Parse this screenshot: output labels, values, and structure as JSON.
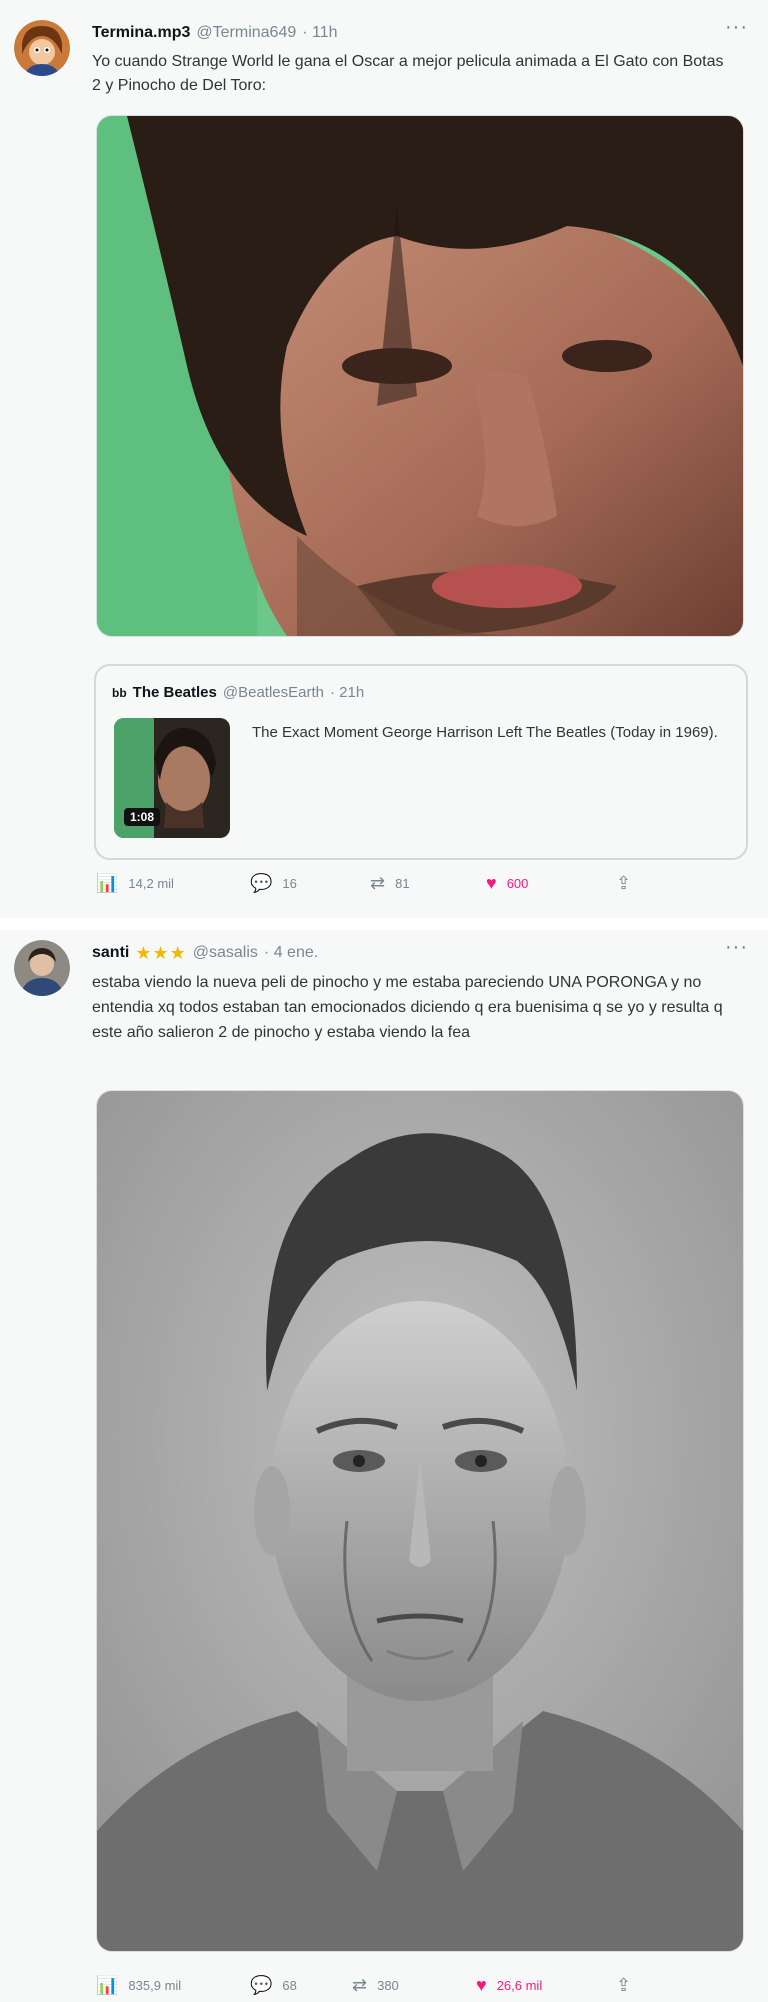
{
  "tweets": [
    {
      "display_name": "Termina.mp3",
      "handle": "@Termina649",
      "time": "· 11h",
      "text": "Yo cuando Strange World le gana el Oscar a mejor pelicula animada a El Gato con Botas 2 y Pinocho de Del Toro:",
      "quote": {
        "account_icon": "bb",
        "display_name": "The Beatles",
        "handle": "@BeatlesEarth",
        "time": "· 21h",
        "text": "The Exact Moment George Harrison Left The Beatles (Today in 1969).",
        "thumb_badge": "1:08"
      },
      "actions": {
        "views": "14,2 mil",
        "replies": "16",
        "retweets": "81",
        "likes": "600"
      }
    },
    {
      "display_name": "santi",
      "stars": "★★★",
      "handle": "@sasalis",
      "time": "· 4 ene.",
      "text": "estaba viendo la nueva peli de pinocho y me estaba pareciendo UNA PORONGA y no entendia xq todos estaban tan emocionados diciendo q era buenisima q se yo y resulta q este año salieron 2 de pinocho y estaba viendo la fea",
      "actions": {
        "views": "835,9 mil",
        "replies": "68",
        "retweets": "380",
        "likes": "26,6 mil"
      }
    }
  ],
  "icons": {
    "more": "···",
    "views": "📊",
    "reply": "💬",
    "retweet": "⇄",
    "like": "♥",
    "share": "⇪"
  },
  "colors": {
    "like_accent": "#f91880",
    "muted_text": "#7a8690",
    "border": "#cfd9de"
  }
}
